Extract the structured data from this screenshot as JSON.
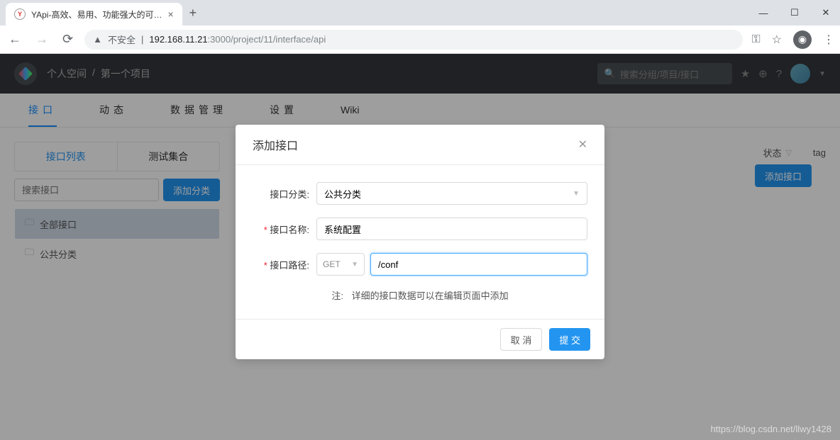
{
  "browser": {
    "tab_title": "YApi-高效、易用、功能强大的可…",
    "url_insecure": "不安全",
    "url_host": "192.168.11.21",
    "url_port_path": ":3000/project/11/interface/api"
  },
  "header": {
    "breadcrumb_space": "个人空间",
    "breadcrumb_sep": "/",
    "breadcrumb_project": "第一个项目",
    "search_placeholder": "搜索分组/项目/接口"
  },
  "nav": {
    "interface": "接口",
    "activity": "动态",
    "data": "数据管理",
    "settings": "设置",
    "wiki": "Wiki"
  },
  "sidebar": {
    "tab_list": "接口列表",
    "tab_test": "测试集合",
    "search_placeholder": "搜索接口",
    "add_category": "添加分类",
    "items": [
      {
        "label": "全部接口"
      },
      {
        "label": "公共分类"
      }
    ]
  },
  "main": {
    "add_interface": "添加接口",
    "col_status": "状态",
    "col_tag": "tag"
  },
  "modal": {
    "title": "添加接口",
    "label_category": "接口分类:",
    "category_value": "公共分类",
    "label_name": "接口名称:",
    "name_value": "系统配置",
    "label_path": "接口路径:",
    "method": "GET",
    "path_value": "/conf",
    "note_label": "注:",
    "note_text": "详细的接口数据可以在编辑页面中添加",
    "cancel": "取 消",
    "submit": "提 交"
  },
  "watermark": "https://blog.csdn.net/llwy1428"
}
